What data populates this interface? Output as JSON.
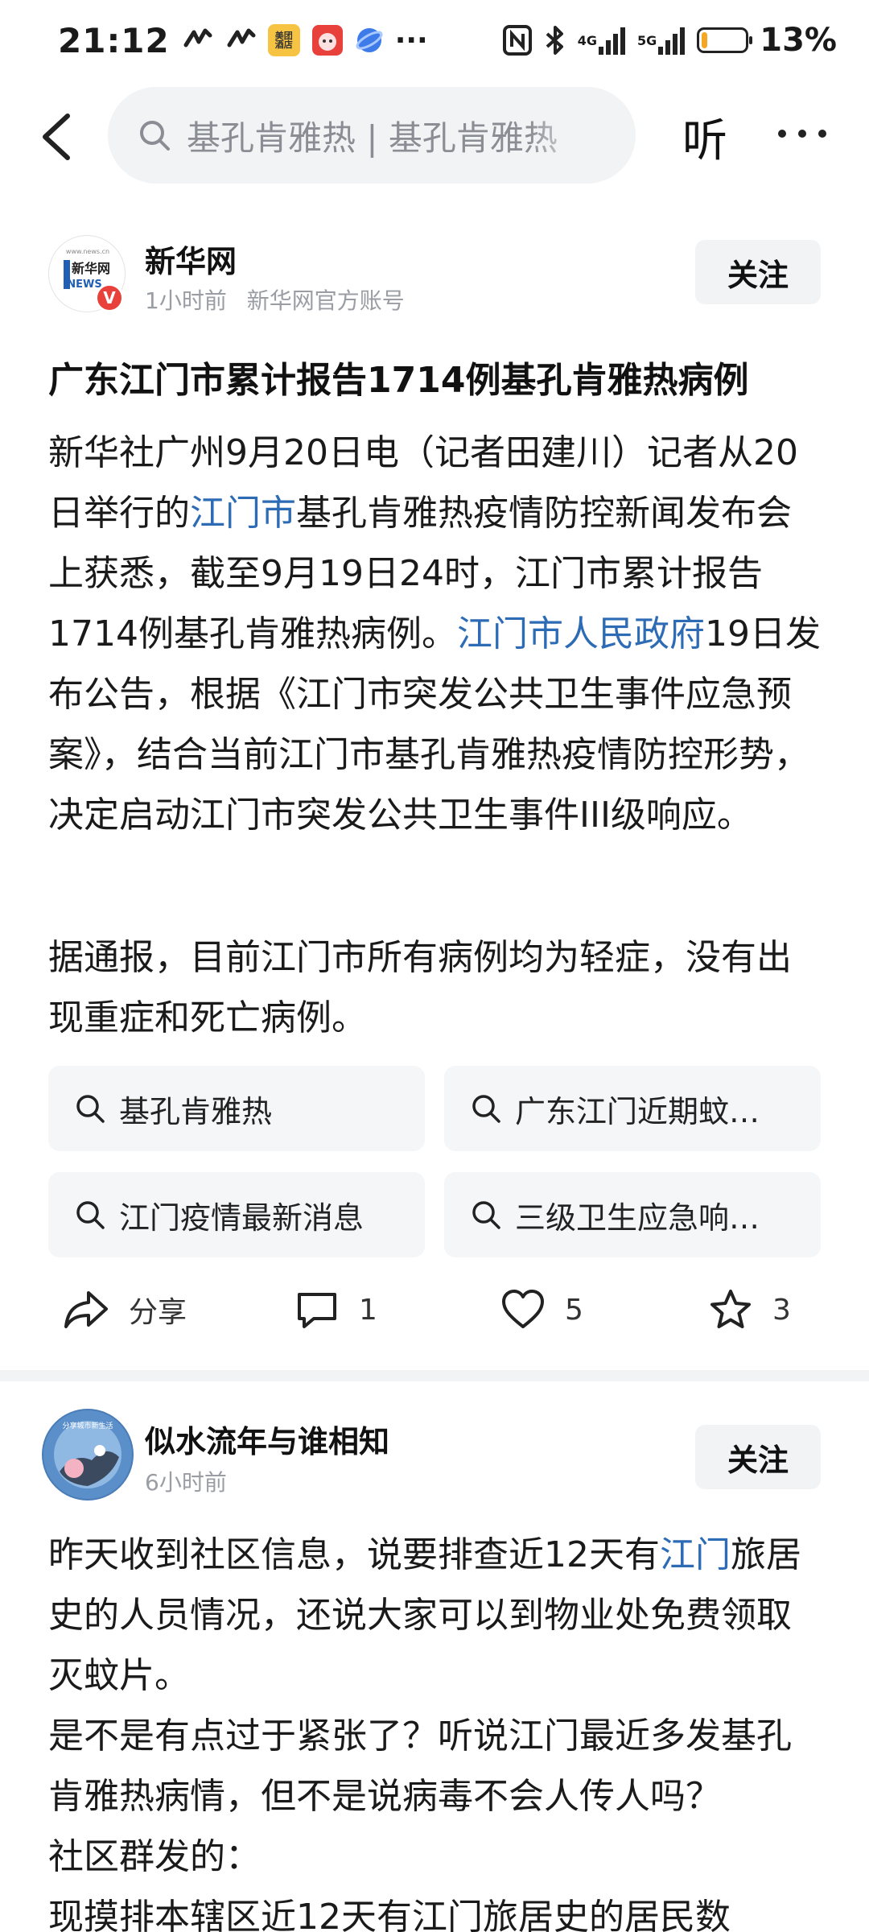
{
  "status_bar": {
    "time": "21:12",
    "app_badge": "美团\n酒店",
    "dots": "···",
    "network_4g": "4G",
    "network_5g": "5G",
    "battery_percent": "13%",
    "battery_level": 0.13,
    "battery_color": "#f5a623"
  },
  "header": {
    "search_text": "基孔肯雅热 | 基孔肯雅热",
    "listen_label": "听"
  },
  "post1": {
    "author": "新华网",
    "avatar_text": "新华网",
    "avatar_sub": "NEWS",
    "avatar_url": "www.news.cn",
    "verified_badge": "V",
    "time": "1小时前",
    "account": "新华网官方账号",
    "follow_label": "关注",
    "title": "广东江门市累计报告1714例基孔肯雅热病例",
    "paragraph1": {
      "t1": "新华社广州9月20日电（记者田建川）记者从20日举行的",
      "link1": "江门市",
      "t2": "基孔肯雅热疫情防控新闻发布会上获悉，截至9月19日24时，江门市累计报告1714例基孔肯雅热病例。",
      "link2": "江门市人民政府",
      "t3": "19日发布公告，根据《江门市突发公共卫生事件应急预案》，结合当前江门市基孔肯雅热疫情防控形势，决定启动江门市突发公共卫生事件III级响应。"
    },
    "paragraph2": "据通报，目前江门市所有病例均为轻症，没有出现重症和死亡病例。",
    "chips": [
      "基孔肯雅热",
      "广东江门近期蚊…",
      "江门疫情最新消息",
      "三级卫生应急响…"
    ],
    "actions": {
      "share_label": "分享",
      "comment_count": "1",
      "like_count": "5",
      "favorite_count": "3"
    }
  },
  "post2": {
    "author": "似水流年与谁相知",
    "avatar_text": "分享城市新生活",
    "time": "6小时前",
    "follow_label": "关注",
    "t1": "昨天收到社区信息，说要排查近12天有",
    "link1": "江门",
    "t2": "旅居史的人员情况，还说大家可以到物业处免费领取灭蚊片。",
    "line3": "是不是有点过于紧张了？听说江门最近多发基孔肯雅热病情，但不是说病毒不会人传人吗？",
    "line4": "社区群发的：",
    "line5": "现摸排本辖区近12天有江门旅居史的居民数"
  },
  "colors": {
    "link": "#2d6bb5",
    "chip_bg": "#f5f6f8",
    "verified": "#e8413c"
  }
}
